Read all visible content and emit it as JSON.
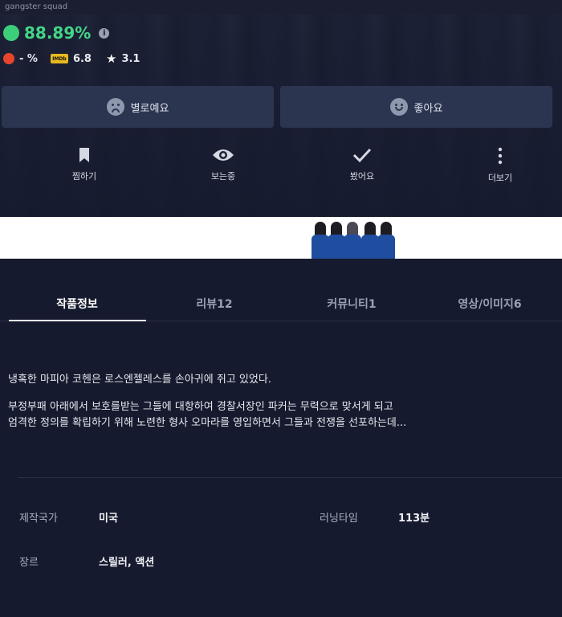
{
  "header": {
    "title": "gangster squad"
  },
  "ratings": {
    "positive_percent": "88.89%",
    "info_icon": "info-icon",
    "rotten_percent": "- %",
    "imdb_label": "IMDb",
    "imdb_score": "6.8",
    "star_score": "3.1"
  },
  "vote": {
    "dislike_label": "별로예요",
    "like_label": "좋아요"
  },
  "actions": [
    {
      "label": "찜하기",
      "icon": "bookmark-icon"
    },
    {
      "label": "보는중",
      "icon": "eye-icon"
    },
    {
      "label": "봤어요",
      "icon": "check-icon"
    },
    {
      "label": "더보기",
      "icon": "more-vertical-icon"
    }
  ],
  "tabs": [
    {
      "label": "작품정보",
      "active": true
    },
    {
      "label": "리뷰12",
      "active": false
    },
    {
      "label": "커뮤니티1",
      "active": false
    },
    {
      "label": "영상/이미지6",
      "active": false
    }
  ],
  "synopsis": {
    "line1": "냉혹한 마피아 코헨은 로스엔젤레스를 손아귀에 쥐고 있었다.",
    "line2": "부정부패 아래에서 보호를받는 그들에 대항하여 경찰서장인 파커는 무력으로 맞서게 되고",
    "line3": "엄격한 정의를 확립하기 위해 노련한 형사 오마라를 영입하면서 그들과 전쟁을 선포하는데..."
  },
  "details": {
    "country_label": "제작국가",
    "country_value": "미국",
    "runtime_label": "러닝타임",
    "runtime_value": "113분",
    "genre_label": "장르",
    "genre_value": "스릴러, 액션"
  },
  "colors": {
    "background": "#161a2e",
    "button": "#2c3550",
    "positive": "#43d687",
    "rotten": "#e8452c",
    "imdb": "#e6b91e"
  }
}
